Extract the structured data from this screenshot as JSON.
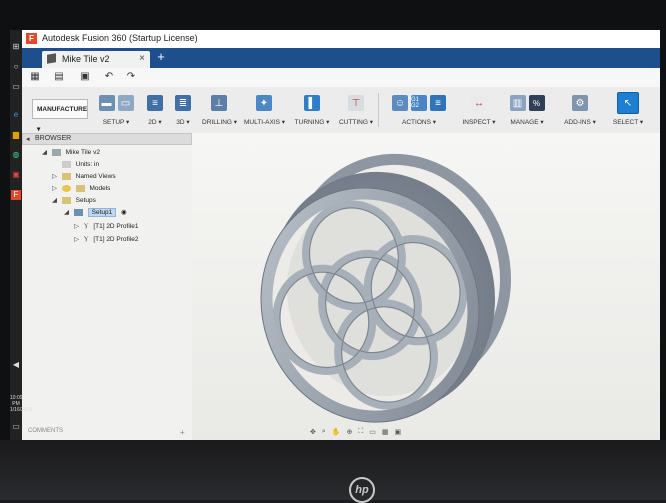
{
  "titlebar": {
    "title": "Autodesk Fusion 360 (Startup License)",
    "app_letter": "F"
  },
  "tabs": {
    "document_tab": "Mike Tile v2",
    "close": "×",
    "new_tab": "+"
  },
  "quick_access": {
    "grid": "▦",
    "file": "▤",
    "save": "▣",
    "undo": "↶",
    "redo": "↷"
  },
  "ribbon": {
    "workspace": "MANUFACTURE ▾",
    "groups": {
      "setup": "SETUP ▾",
      "two_d": "2D ▾",
      "three_d": "3D ▾",
      "drilling": "DRILLING ▾",
      "multi_axis": "MULTI-AXIS ▾",
      "turning": "TURNING ▾",
      "cutting": "CUTTING ▾",
      "actions": "ACTIONS ▾",
      "inspect": "INSPECT ▾",
      "manage": "MANAGE ▾",
      "add_ins": "ADD-INS ▾",
      "select": "SELECT ▾"
    },
    "actions_icon_text": "G1 G2",
    "manage_icon_text": "%"
  },
  "browser": {
    "header": "BROWSER",
    "root": "Mike Tile v2",
    "units": "Units: in",
    "named_views": "Named Views",
    "models": "Models",
    "setups": "Setups",
    "setup1": "Setup1",
    "profile1": "[T1] 2D Profile1",
    "profile2": "[T1] 2D Profile2"
  },
  "taskbar": {
    "time": "10:09 PM",
    "date": "1/16/2019"
  },
  "footer": {
    "comments": "COMMENTS",
    "comments_plus": "+"
  },
  "bezel": {
    "brand": "hp"
  },
  "colors": {
    "tab_bar": "#1d4f8c",
    "select_accent": "#1e7fd1",
    "model": "#9fa7b2"
  }
}
